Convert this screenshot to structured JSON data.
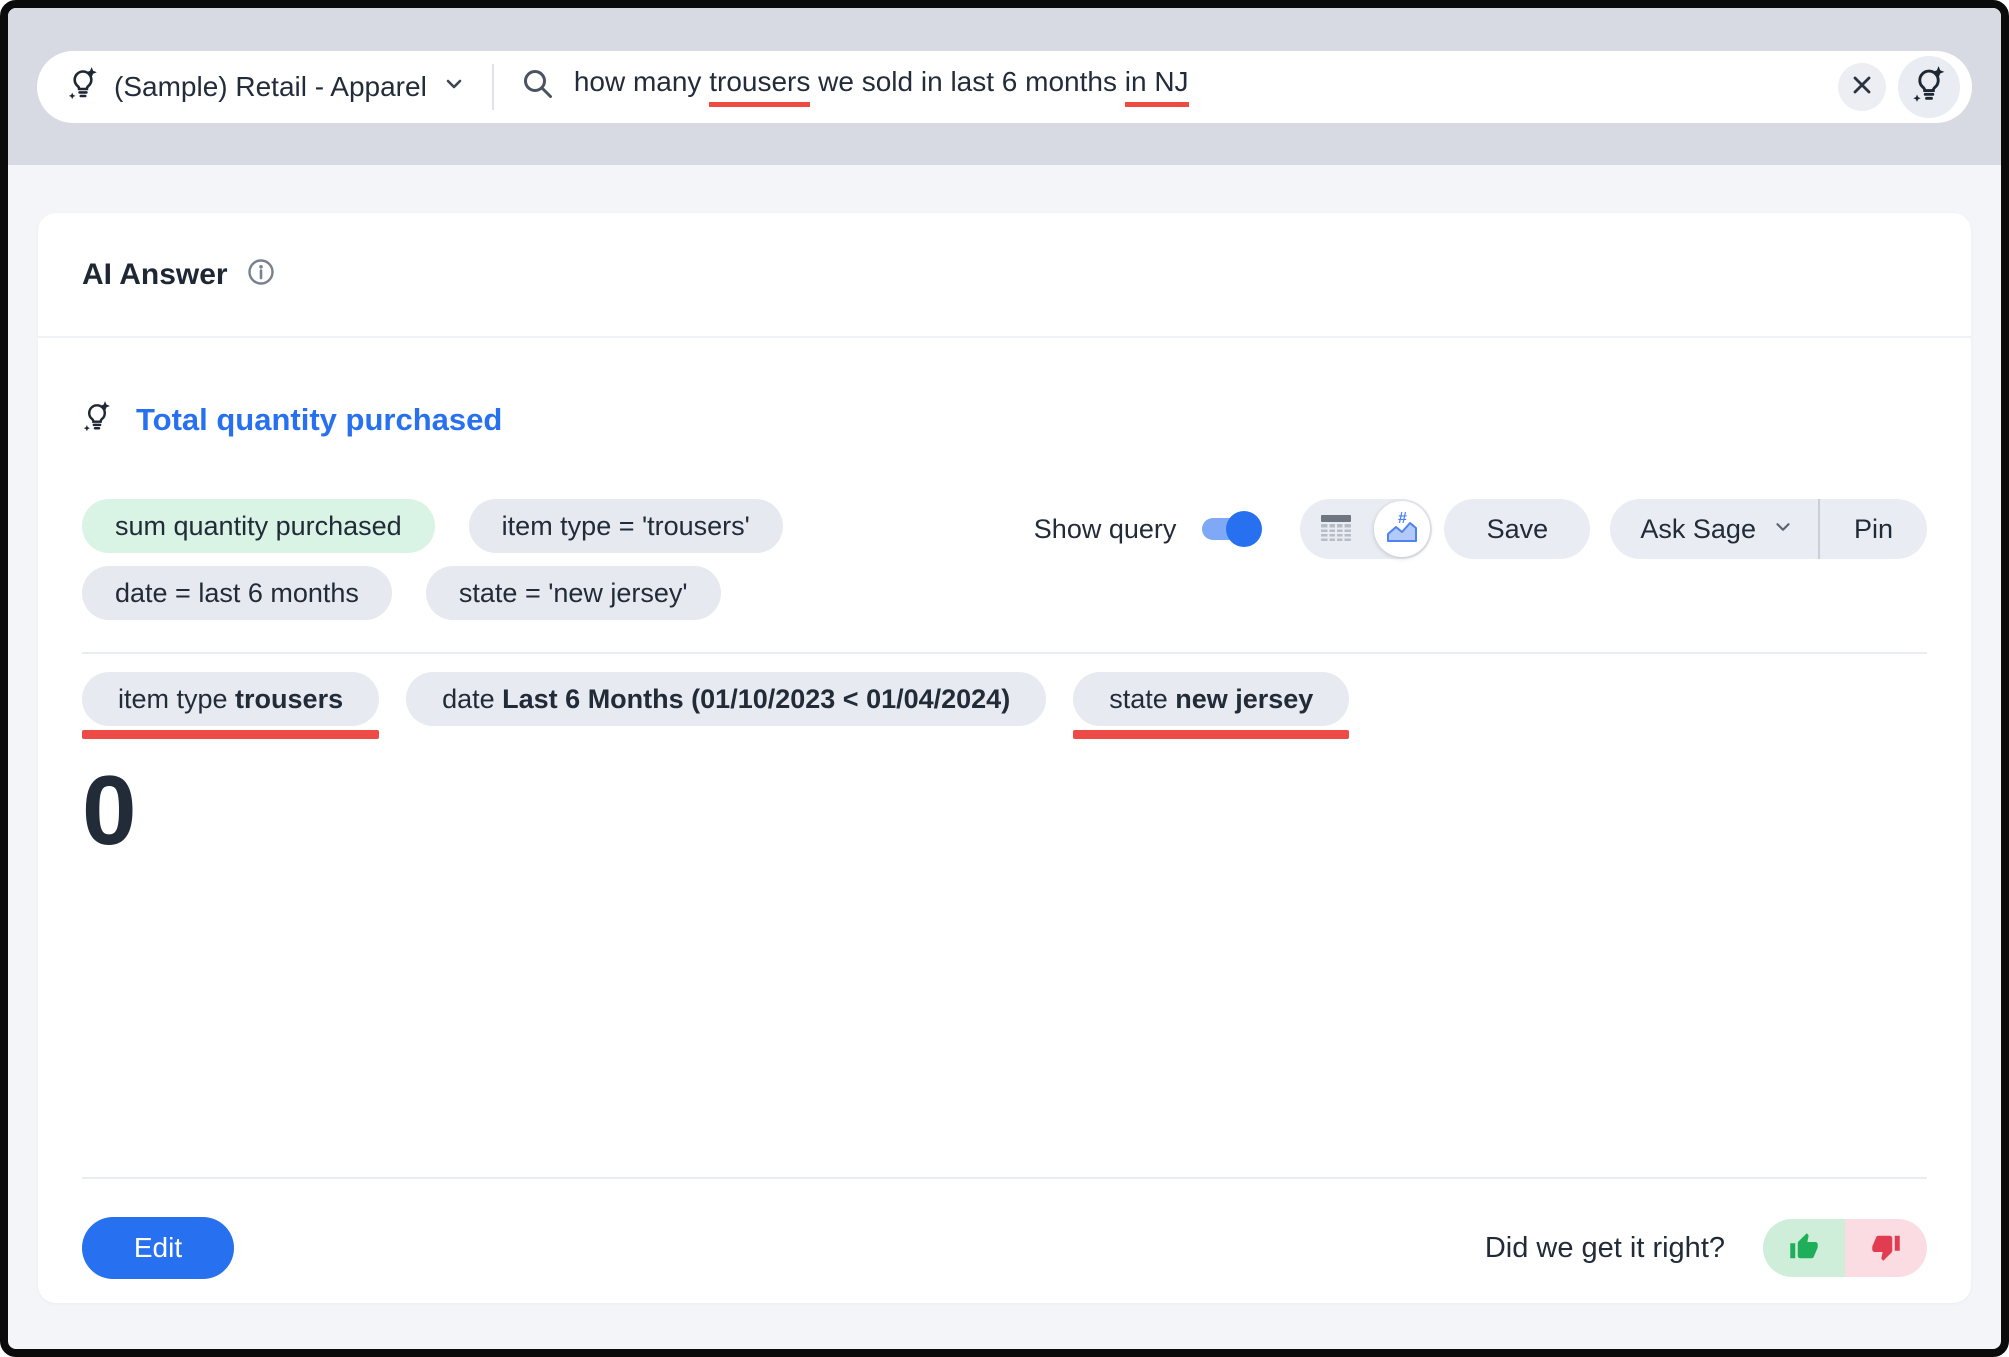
{
  "search_bar": {
    "datasource": {
      "label": "(Sample) Retail - Apparel"
    },
    "query": {
      "full_text": "how many trousers we sold in last 6 months in NJ",
      "segments": [
        {
          "text": "how many ",
          "underlined": false
        },
        {
          "text": "trousers",
          "underlined": true
        },
        {
          "text": " we sold in last 6 months ",
          "underlined": false
        },
        {
          "text": "in NJ",
          "underlined": true
        }
      ]
    }
  },
  "answer_card": {
    "header": {
      "title": "AI Answer"
    },
    "result": {
      "title": "Total quantity purchased",
      "tokens": [
        {
          "text": "sum quantity purchased",
          "kind": "measure"
        },
        {
          "text": "item type = 'trousers'",
          "kind": "filter"
        },
        {
          "text": "date = last 6 months",
          "kind": "filter"
        },
        {
          "text": "state = 'new jersey'",
          "kind": "filter"
        }
      ],
      "toolbar": {
        "show_query_label": "Show query",
        "show_query_on": true,
        "save_label": "Save",
        "ask_sage_label": "Ask Sage",
        "pin_label": "Pin"
      },
      "filters": [
        {
          "label": "item type ",
          "value": "trousers",
          "highlighted": true
        },
        {
          "label": "date ",
          "value": "Last 6 Months (01/10/2023 < 01/04/2024)",
          "highlighted": false
        },
        {
          "label": "state ",
          "value": "new jersey",
          "highlighted": true
        }
      ],
      "value": "0"
    },
    "footer": {
      "edit_label": "Edit",
      "feedback_prompt": "Did we get it right?"
    }
  },
  "icons": {
    "sage": "lightbulb-with-sparkles",
    "search": "magnifier",
    "clear": "x-cross",
    "info": "circled-i",
    "table_view": "data-table",
    "chart_view": "kpi-area-chart",
    "thumbs_up": "thumbs-up",
    "thumbs_down": "thumbs-down"
  },
  "colors": {
    "accent_blue": "#2770ef",
    "underline_red": "#ef4b42",
    "measure_chip_green": "#d9f3e5",
    "chip_gray": "#e6e9ef",
    "feedback_green_bg": "#cfeeda",
    "feedback_red_bg": "#fbdce2",
    "thumb_green": "#1fae5a",
    "thumb_red": "#e23c50",
    "topbar_bg": "#d7dae2",
    "page_bg": "#f3f5f9",
    "text_dark": "#222b38"
  }
}
